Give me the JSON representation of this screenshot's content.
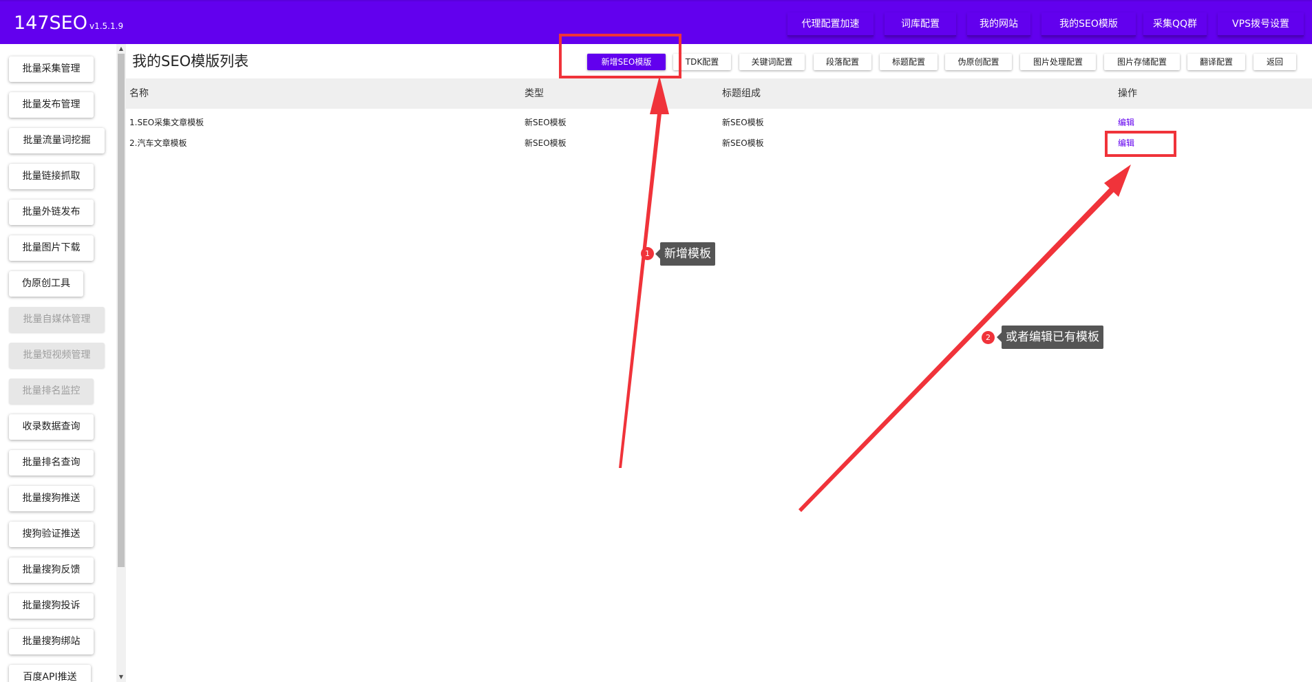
{
  "app": {
    "title": "147SEO",
    "version": "v1.5.1.9"
  },
  "top_nav": [
    "代理配置加速",
    "词库配置",
    "我的网站",
    "我的SEO模版",
    "采集QQ群",
    "VPS拨号设置"
  ],
  "sidebar": {
    "items": [
      {
        "label": "批量采集管理",
        "disabled": false
      },
      {
        "label": "批量发布管理",
        "disabled": false
      },
      {
        "label": "批量流量词挖掘",
        "disabled": false
      },
      {
        "label": "批量链接抓取",
        "disabled": false
      },
      {
        "label": "批量外链发布",
        "disabled": false
      },
      {
        "label": "批量图片下载",
        "disabled": false
      },
      {
        "label": "伪原创工具",
        "disabled": false
      },
      {
        "label": "批量自媒体管理",
        "disabled": true
      },
      {
        "label": "批量短视频管理",
        "disabled": true
      },
      {
        "label": "批量排名监控",
        "disabled": true
      },
      {
        "label": "收录数据查询",
        "disabled": false
      },
      {
        "label": "批量排名查询",
        "disabled": false
      },
      {
        "label": "批量搜狗推送",
        "disabled": false
      },
      {
        "label": "搜狗验证推送",
        "disabled": false
      },
      {
        "label": "批量搜狗反馈",
        "disabled": false
      },
      {
        "label": "批量搜狗投诉",
        "disabled": false
      },
      {
        "label": "批量搜狗绑站",
        "disabled": false
      },
      {
        "label": "百度API推送",
        "disabled": false
      }
    ]
  },
  "main": {
    "title": "我的SEO模版列表",
    "toolbar": {
      "new_button": "新增SEO模版",
      "buttons": [
        "TDK配置",
        "关键词配置",
        "段落配置",
        "标题配置",
        "伪原创配置",
        "图片处理配置",
        "图片存储配置",
        "翻译配置",
        "返回"
      ]
    },
    "table": {
      "headers": [
        "名称",
        "类型",
        "标题组成",
        "操作"
      ],
      "rows": [
        {
          "name": "1.SEO采集文章模板",
          "type": "新SEO模板",
          "title_comp": "新SEO模板",
          "action": "编辑"
        },
        {
          "name": "2.汽车文章模板",
          "type": "新SEO模板",
          "title_comp": "新SEO模板",
          "action": "编辑"
        }
      ]
    }
  },
  "annotations": [
    {
      "number": "1",
      "text": "新增模板"
    },
    {
      "number": "2",
      "text": "或者编辑已有模板"
    }
  ],
  "colors": {
    "brand": "#6200ee",
    "annotation": "#f0333a",
    "tooltip_bg": "#555555",
    "header_bg": "#efefef"
  }
}
